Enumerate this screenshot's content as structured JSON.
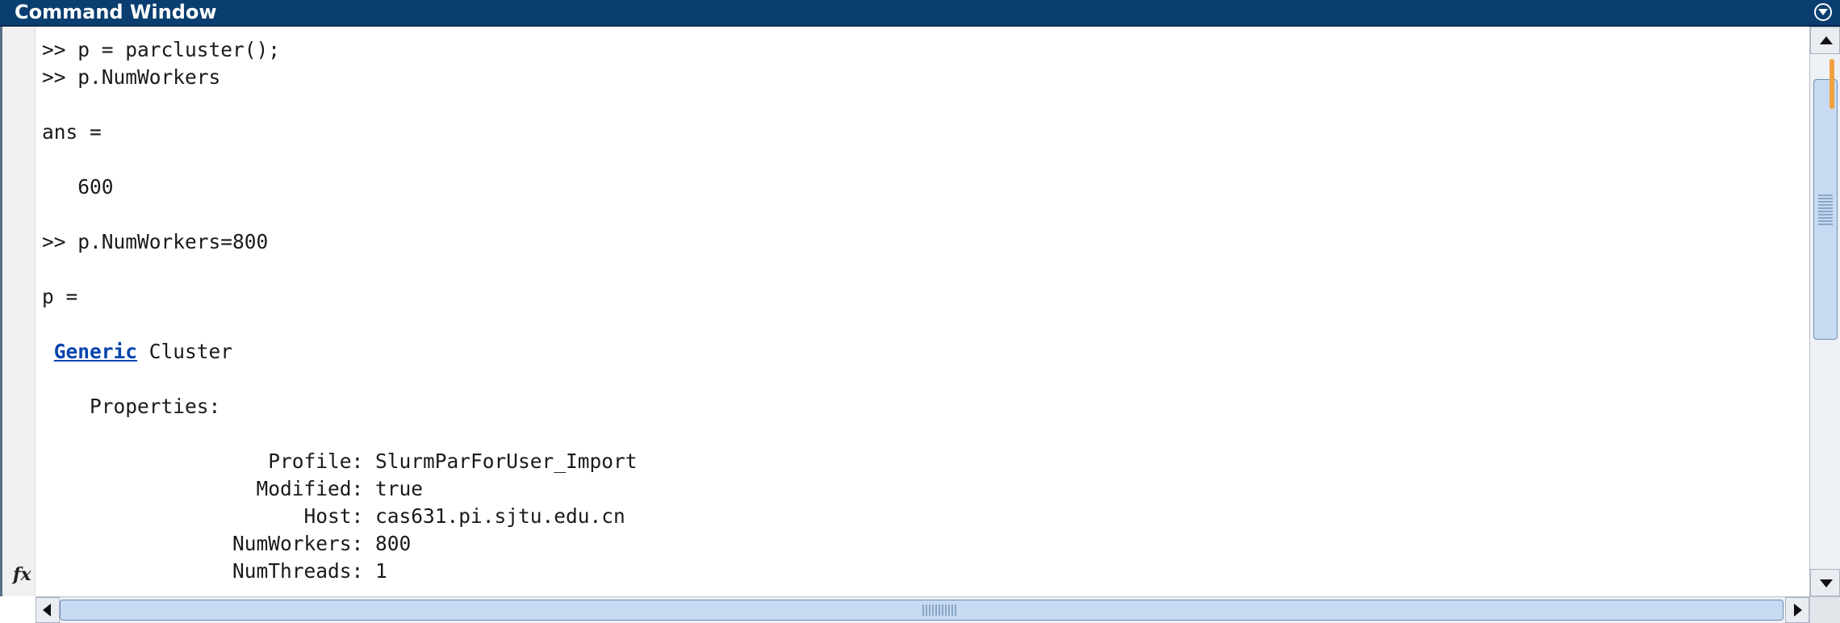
{
  "window": {
    "title": "Command Window"
  },
  "console": {
    "lines": [
      ">> p = parcluster();",
      ">> p.NumWorkers",
      "",
      "ans =",
      "",
      "   600",
      "",
      ">> p.NumWorkers=800",
      "",
      "p =",
      "",
      "",
      "",
      "    Properties:",
      "",
      "                   Profile: SlurmParForUser_Import",
      "                  Modified: true",
      "                      Host: cas631.pi.sjtu.edu.cn",
      "                NumWorkers: 800",
      "                NumThreads: 1"
    ],
    "generic_line": {
      "prefix": " ",
      "link": "Generic",
      "rest": " Cluster"
    }
  },
  "gutter": {
    "fx_label": "fx"
  },
  "icons": {
    "title_menu": "chevron-down-circle-icon",
    "scroll_up": "arrow-up-icon",
    "scroll_down": "arrow-down-icon",
    "scroll_left": "arrow-left-icon",
    "scroll_right": "arrow-right-icon"
  },
  "colors": {
    "titlebar": "#0b3e70",
    "link": "#0645ad",
    "scrollbar_thumb": "#c7daf1",
    "scroll_marker": "#f2a03f"
  }
}
